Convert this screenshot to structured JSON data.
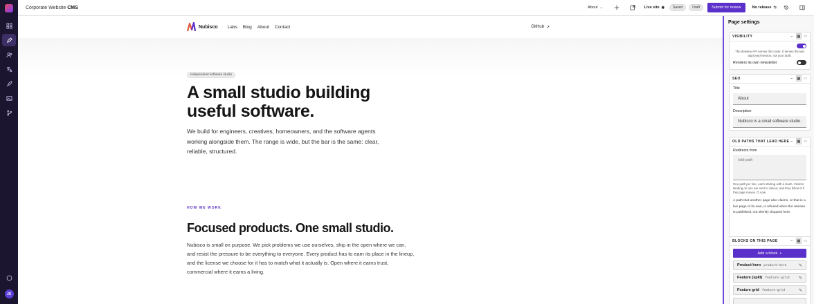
{
  "topbar": {
    "app_title": "Corporate Website",
    "app_title_bold": "CMS",
    "page_select": "About",
    "live_site": "Live site",
    "saved_badge": "Saved",
    "draft_badge": "Draft",
    "submit_button": "Submit for review",
    "release_select": "No release"
  },
  "rail": {
    "avatar_initials": "JS",
    "icons": [
      "grid-icon",
      "pencil-icon",
      "users-icon",
      "translate-icon",
      "rocket-icon",
      "image-icon",
      "branch-icon"
    ]
  },
  "site": {
    "brand": "Nubisco",
    "nav": [
      "Labs",
      "Blog",
      "About",
      "Contact"
    ],
    "github": "GitHub",
    "hero_chip": "Independent software studio",
    "hero_title": "A small studio building useful software.",
    "hero_lede": "We build for engineers, creatives, homeowners, and the software agents working alongside them. The range is wide, but the bar is the same: clear, reliable, structured.",
    "section_eyebrow": "HOW WE WORK",
    "section_title": "Focused products. One small studio.",
    "section_body": "Nubisco is small on purpose. We pick problems we use ourselves, ship in the open where we can, and resist the pressure to be everything to everyone. Every product has to earn its place in the lineup, and the license we choose for it has to match what it actually is. Open where it earns trust, commercial where it earns a living."
  },
  "panel": {
    "title": "Page settings",
    "visibility": {
      "header": "VISIBILITY",
      "toggle_on": true,
      "note": "The delivery API serves this route. It serves the last approved version, not your draft.",
      "newsletter_label": "Renders its own newsletter",
      "newsletter_on": false
    },
    "seo": {
      "header": "SEO",
      "title_label": "Title",
      "title_value": "About",
      "description_label": "Description",
      "description_value": "Nubisco is a small software studio."
    },
    "redirects": {
      "header": "OLD PATHS THAT LEAD HERE",
      "label": "Redirects from",
      "placeholder": "/old-path",
      "note": "One path per line, each starting with a slash. Visitors landing on one are sent to /about, and they follow it if this page moves. O now.",
      "warning": "A path that another page also claims, or that is a live page of its own, is refused when the release is published, not silently dropped here."
    },
    "blocks": {
      "header": "BLOCKS ON THIS PAGE",
      "add_button": "Add a block",
      "items": [
        {
          "name": "Product hero",
          "type": "product-hero"
        },
        {
          "name": "Feature (split)",
          "type": "feature-split"
        },
        {
          "name": "Feature grid",
          "type": "feature-grid"
        }
      ]
    }
  },
  "colors": {
    "accent": "#5b2fc9",
    "rail": "#1b1530"
  }
}
